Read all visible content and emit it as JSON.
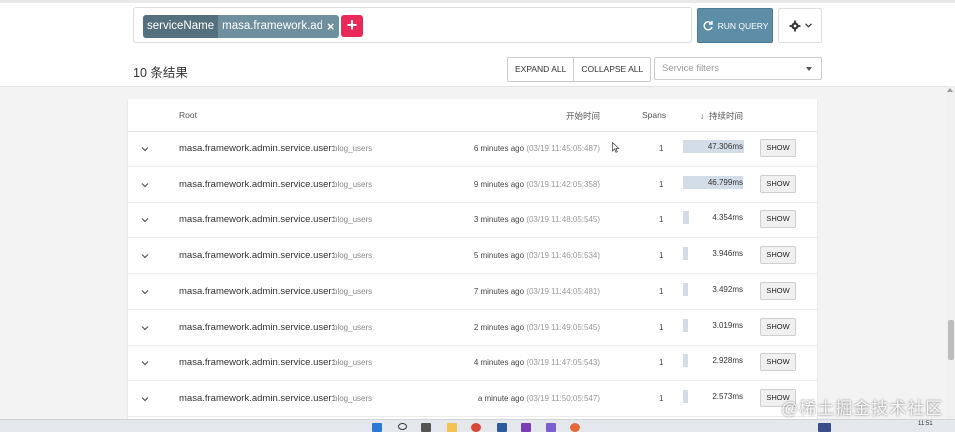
{
  "search": {
    "tag_key": "serviceName",
    "tag_value": "masa.framework.ad...",
    "tag_remove": "×",
    "add": "+",
    "run_query": "RUN QUERY"
  },
  "results": {
    "count_label": "10 条结果",
    "expand_all": "EXPAND ALL",
    "collapse_all": "COLLAPSE ALL",
    "service_filter_placeholder": "Service filters"
  },
  "table": {
    "headers": {
      "root": "Root",
      "start_time": "开始时间",
      "spans": "Spans",
      "duration": "持续时间"
    },
    "show_label": "SHOW",
    "rows": [
      {
        "service": "masa.framework.admin.service.user:",
        "operation": "blog_users",
        "relative": "6 minutes ago",
        "absolute": "(03/19 11:45:05:487)",
        "spans": "1",
        "duration": "47.306ms",
        "fill": 1.0
      },
      {
        "service": "masa.framework.admin.service.user:",
        "operation": "blog_users",
        "relative": "9 minutes ago",
        "absolute": "(03/19 11:42:05:358)",
        "spans": "1",
        "duration": "46.799ms",
        "fill": 0.99
      },
      {
        "service": "masa.framework.admin.service.user:",
        "operation": "blog_users",
        "relative": "3 minutes ago",
        "absolute": "(03/19 11:48:05:545)",
        "spans": "1",
        "duration": "4.354ms",
        "fill": 0.092
      },
      {
        "service": "masa.framework.admin.service.user:",
        "operation": "blog_users",
        "relative": "5 minutes ago",
        "absolute": "(03/19 11:46:05:534)",
        "spans": "1",
        "duration": "3.946ms",
        "fill": 0.083
      },
      {
        "service": "masa.framework.admin.service.user:",
        "operation": "blog_users",
        "relative": "7 minutes ago",
        "absolute": "(03/19 11:44:05:481)",
        "spans": "1",
        "duration": "3.492ms",
        "fill": 0.074
      },
      {
        "service": "masa.framework.admin.service.user:",
        "operation": "blog_users",
        "relative": "2 minutes ago",
        "absolute": "(03/19 11:49:05:545)",
        "spans": "1",
        "duration": "3.019ms",
        "fill": 0.064
      },
      {
        "service": "masa.framework.admin.service.user:",
        "operation": "blog_users",
        "relative": "4 minutes ago",
        "absolute": "(03/19 11:47:05:543)",
        "spans": "1",
        "duration": "2.928ms",
        "fill": 0.062
      },
      {
        "service": "masa.framework.admin.service.user:",
        "operation": "blog_users",
        "relative": "a minute ago",
        "absolute": "(03/19 11:50:05:547)",
        "spans": "1",
        "duration": "2.573ms",
        "fill": 0.054
      }
    ]
  },
  "taskbar": {
    "clock": "11:51"
  },
  "watermark": "@稀土掘金技术社区",
  "colors": {
    "accent_add": "#e8295a",
    "run_query_bg": "#5e8da8",
    "chip_key_bg": "#54707e",
    "chip_value_bg": "#6f8f9f",
    "duration_bar": "#d3dde8"
  }
}
